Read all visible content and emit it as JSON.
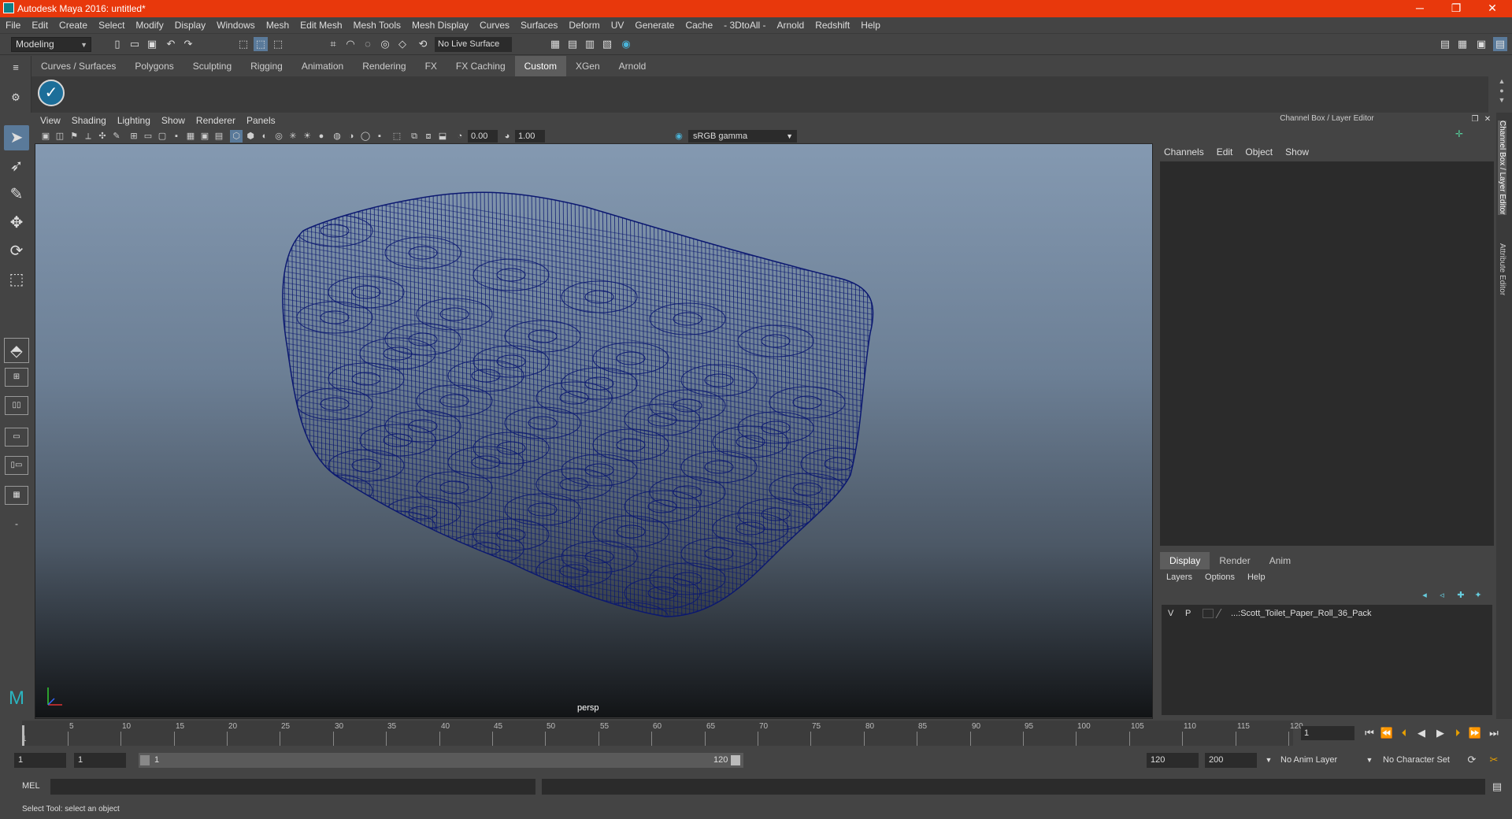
{
  "window": {
    "title": "Autodesk Maya 2016: untitled*",
    "minimize": "─",
    "maximize": "❐",
    "close": "✕"
  },
  "menubar": [
    "File",
    "Edit",
    "Create",
    "Select",
    "Modify",
    "Display",
    "Windows",
    "Mesh",
    "Edit Mesh",
    "Mesh Tools",
    "Mesh Display",
    "Curves",
    "Surfaces",
    "Deform",
    "UV",
    "Generate",
    "Cache",
    "- 3DtoAll -",
    "Arnold",
    "Redshift",
    "Help"
  ],
  "statusline": {
    "mode": "Modeling",
    "live_surface": "No Live Surface"
  },
  "shelf": {
    "tabs": [
      "Curves / Surfaces",
      "Polygons",
      "Sculpting",
      "Rigging",
      "Animation",
      "Rendering",
      "FX",
      "FX Caching",
      "Custom",
      "XGen",
      "Arnold"
    ],
    "active_tab": "Custom",
    "check_icon": "✓"
  },
  "viewport": {
    "menu": [
      "View",
      "Shading",
      "Lighting",
      "Show",
      "Renderer",
      "Panels"
    ],
    "exposure": "0.00",
    "gamma": "1.00",
    "color_space": "sRGB gamma",
    "camera_label": "persp",
    "wire_color": "#0b1870"
  },
  "channel_box": {
    "title": "Channel Box / Layer Editor",
    "menu": [
      "Channels",
      "Edit",
      "Object",
      "Show"
    ],
    "layer_tabs": [
      "Display",
      "Render",
      "Anim"
    ],
    "active_layer_tab": "Display",
    "layer_menu": [
      "Layers",
      "Options",
      "Help"
    ],
    "layer": {
      "v": "V",
      "p": "P",
      "name": "...:Scott_Toilet_Paper_Roll_36_Pack"
    },
    "side_tabs": [
      "Channel Box / Layer Editor",
      "Attribute Editor"
    ]
  },
  "timeslider": {
    "ticks": [
      "5",
      "10",
      "15",
      "20",
      "25",
      "30",
      "35",
      "40",
      "45",
      "50",
      "55",
      "60",
      "65",
      "70",
      "75",
      "80",
      "85",
      "90",
      "95",
      "100",
      "105",
      "110",
      "115",
      "120"
    ],
    "first_label": "1",
    "current_frame": "1"
  },
  "range": {
    "start": "1",
    "playback_start": "1",
    "slider_start": "1",
    "slider_end": "120",
    "playback_end": "120",
    "end": "200",
    "anim_layer": "No Anim Layer",
    "character_set": "No Character Set"
  },
  "cmdline": {
    "label": "MEL"
  },
  "helpline": {
    "text": "Select Tool: select an object"
  }
}
